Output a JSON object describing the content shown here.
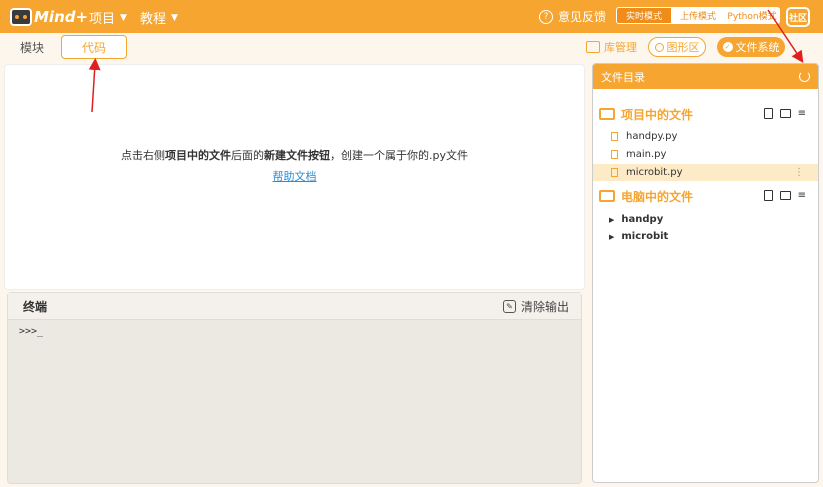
{
  "app": {
    "logo_text": "Mind+"
  },
  "topbar": {
    "menu_project": "项目",
    "menu_tutorial": "教程",
    "feedback": "意见反馈",
    "mode_live": "实时模式",
    "mode_upload": "上传模式",
    "mode_python": "Python模式",
    "community_badge": "社区"
  },
  "tabs": {
    "module": "模块",
    "code": "代码"
  },
  "toolbar": {
    "library": "库管理",
    "graph": "图形区",
    "filesystem": "文件系统"
  },
  "editor": {
    "hint_prefix": "点击右侧",
    "hint_bold1": "项目中的文件",
    "hint_mid": "后面的",
    "hint_bold2": "新建文件按钮",
    "hint_suffix": "，创建一个属于你的.py文件",
    "help_link": "帮助文档"
  },
  "terminal": {
    "title": "终端",
    "clear": "清除输出",
    "prompt": ">>>_"
  },
  "filepanel": {
    "title": "文件目录",
    "project_section": "项目中的文件",
    "project_files": [
      "handpy.py",
      "main.py",
      "microbit.py"
    ],
    "selected_file": "microbit.py",
    "computer_section": "电脑中的文件",
    "computer_folders": [
      "handpy",
      "microbit"
    ]
  },
  "colors": {
    "accent": "#f6a531",
    "link": "#2a8dd4",
    "annotation": "#e02020"
  }
}
